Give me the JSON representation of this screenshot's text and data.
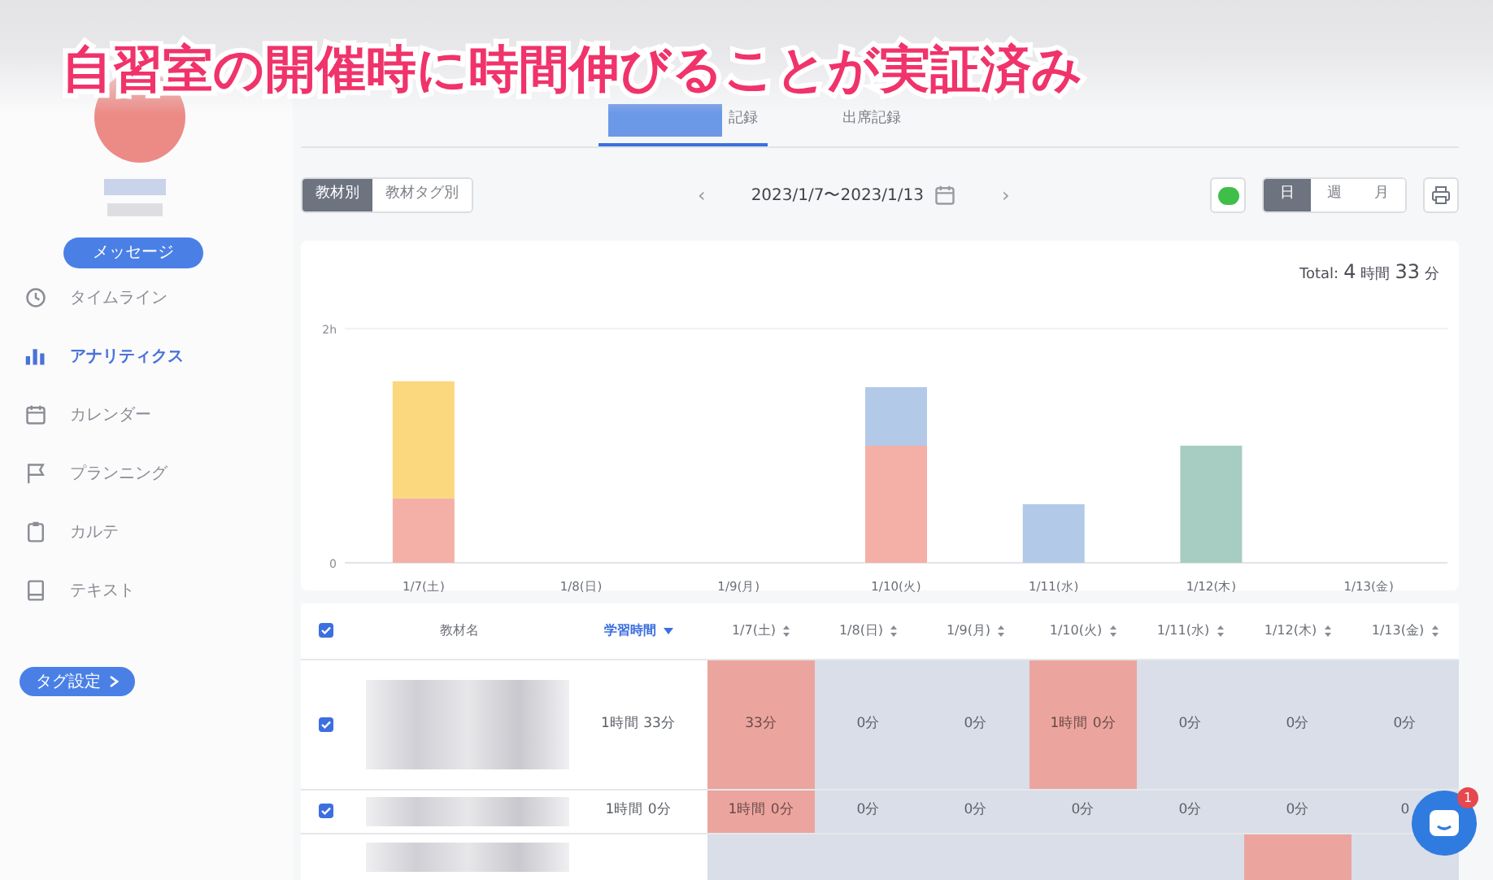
{
  "caption": "自習室の開催時に時間伸びることが実証済み",
  "sidebar": {
    "button": "メッセージ",
    "items": [
      {
        "label": "タイムライン",
        "selected": false
      },
      {
        "label": "アナリティクス",
        "selected": true
      },
      {
        "label": "カレンダー",
        "selected": false
      },
      {
        "label": "プランニング",
        "selected": false
      },
      {
        "label": "カルテ",
        "selected": false
      },
      {
        "label": "テキスト",
        "selected": false
      }
    ],
    "tag_button": "タグ設定"
  },
  "tabs": [
    {
      "label": "記録",
      "selected": true
    },
    {
      "label": "出席記録",
      "selected": false
    }
  ],
  "view_toggle": [
    {
      "label": "教材別",
      "selected": true
    },
    {
      "label": "教材タグ別",
      "selected": false
    }
  ],
  "date_nav": {
    "prev": "‹",
    "range": "2023/1/7〜2023/1/13",
    "next": "›"
  },
  "period_toggle": [
    {
      "label": "日",
      "selected": true
    },
    {
      "label": "週",
      "selected": false
    },
    {
      "label": "月",
      "selected": false
    }
  ],
  "total": {
    "label": "Total:",
    "hours": "4",
    "hours_unit": "時間",
    "minutes": "33",
    "minutes_unit": "分"
  },
  "chart_data": {
    "type": "bar",
    "stacked": true,
    "categories": [
      "1/7(土)",
      "1/8(日)",
      "1/9(月)",
      "1/10(火)",
      "1/11(水)",
      "1/12(木)",
      "1/13(金)"
    ],
    "ylim": [
      0,
      2
    ],
    "yticks": [
      {
        "value": 0,
        "label": "0"
      },
      {
        "value": 2,
        "label": "2h"
      }
    ],
    "series": [
      {
        "color": "#f4b0a6",
        "values": [
          0.55,
          0,
          0,
          1,
          0,
          0,
          0
        ]
      },
      {
        "color": "#fbd77e",
        "values": [
          1,
          0,
          0,
          0,
          0,
          0,
          0
        ]
      },
      {
        "color": "#b3c9e8",
        "values": [
          0,
          0,
          0,
          0.5,
          0.5,
          0,
          0
        ]
      },
      {
        "color": "#a7cdc2",
        "values": [
          0,
          0,
          0,
          0,
          0,
          1,
          0
        ]
      }
    ]
  },
  "table": {
    "select_all_checked": true,
    "columns": [
      {
        "label": "教材名",
        "kind": "plain"
      },
      {
        "label": "学習時間",
        "kind": "sorted"
      },
      {
        "label": "1/7(土)",
        "kind": "sortable"
      },
      {
        "label": "1/8(日)",
        "kind": "sortable"
      },
      {
        "label": "1/9(月)",
        "kind": "sortable"
      },
      {
        "label": "1/10(火)",
        "kind": "sortable"
      },
      {
        "label": "1/11(水)",
        "kind": "sortable"
      },
      {
        "label": "1/12(木)",
        "kind": "sortable"
      },
      {
        "label": "1/13(金)",
        "kind": "sortable"
      }
    ],
    "rows": [
      {
        "checked": true,
        "cells": [
          {},
          {
            "text": "1時間 33分"
          },
          {
            "text": "33分",
            "highlighted": true
          },
          {
            "text": "0分",
            "highlighted": false
          },
          {
            "text": "0分",
            "highlighted": false
          },
          {
            "text": "1時間 0分",
            "highlighted": true
          },
          {
            "text": "0分",
            "highlighted": false
          },
          {
            "text": "0分",
            "highlighted": false
          },
          {
            "text": "0分",
            "highlighted": false
          }
        ]
      },
      {
        "checked": true,
        "cells": [
          {},
          {
            "text": "1時間 0分"
          },
          {
            "text": "1時間 0分",
            "highlighted": true
          },
          {
            "text": "0分",
            "highlighted": false
          },
          {
            "text": "0分",
            "highlighted": false
          },
          {
            "text": "0分",
            "highlighted": false
          },
          {
            "text": "0分",
            "highlighted": false
          },
          {
            "text": "0分",
            "highlighted": false
          },
          {
            "text": "0",
            "highlighted": false
          }
        ]
      },
      {
        "cells": [
          {},
          {},
          {
            "highlighted": false
          },
          {
            "highlighted": false
          },
          {
            "highlighted": false
          },
          {
            "highlighted": false
          },
          {
            "highlighted": false
          },
          {
            "highlighted": true
          },
          {
            "highlighted": false
          }
        ]
      }
    ]
  },
  "chat": {
    "badge": "1"
  }
}
